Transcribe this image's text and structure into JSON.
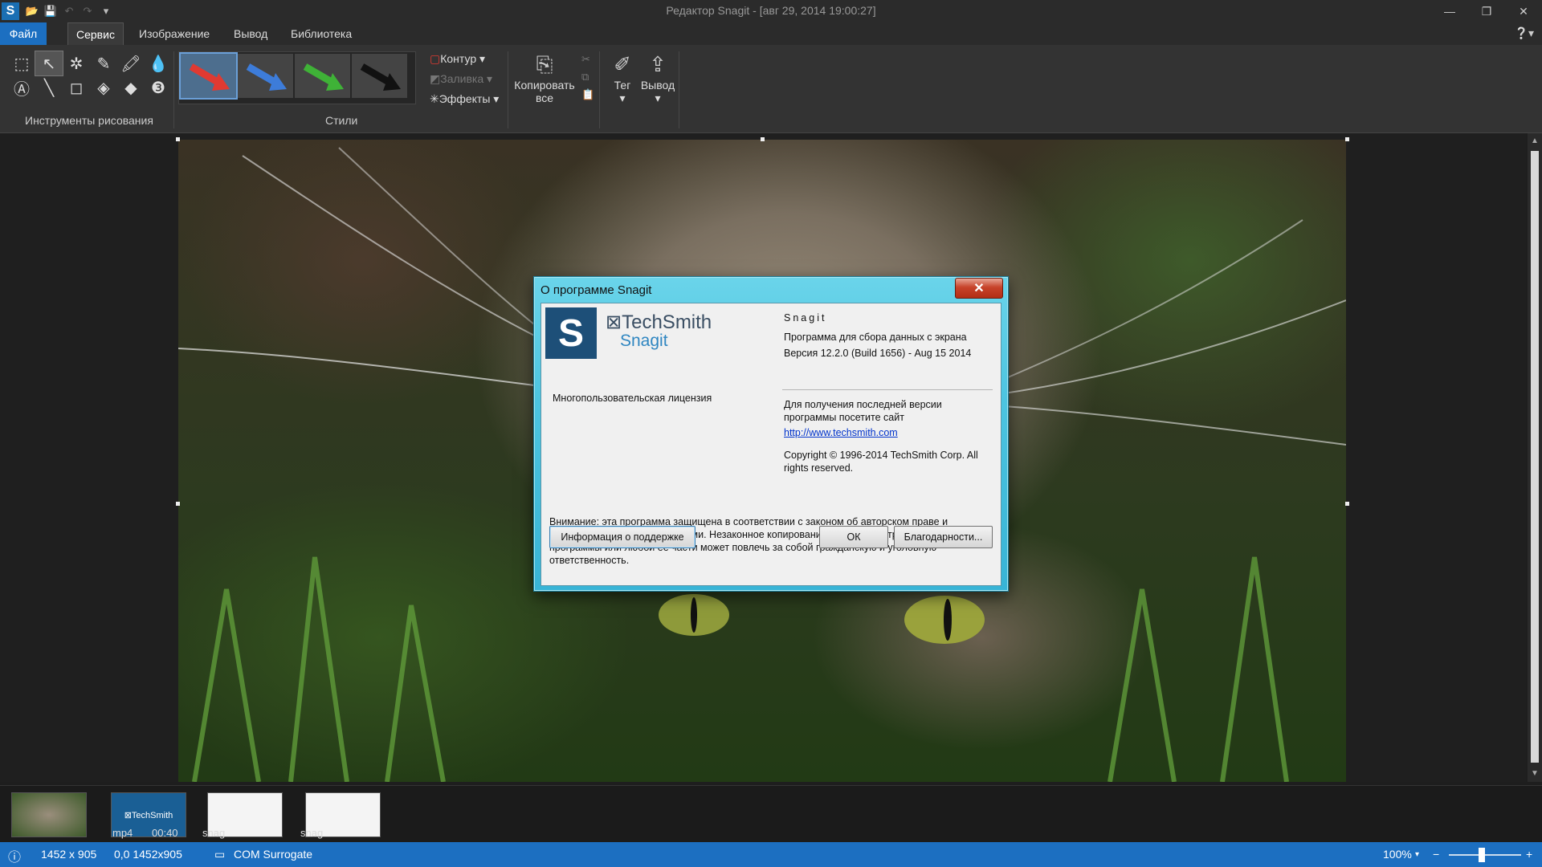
{
  "window": {
    "title": "Редактор Snagit - [авг 29, 2014 19:00:27]"
  },
  "menu": {
    "tabs": [
      "Файл",
      "Сервис",
      "Изображение",
      "Вывод",
      "Библиотека"
    ]
  },
  "ribbon": {
    "drawing_tools_label": "Инструменты рисования",
    "styles_label": "Стили",
    "outline_label": "Контур",
    "fill_label": "Заливка",
    "effects_label": "Эффекты",
    "copy_all_label": "Копировать все",
    "tag_label": "Тег",
    "output_label": "Вывод",
    "style_colors": [
      "#e03a32",
      "#3d7cd9",
      "#3fb237",
      "#111111"
    ]
  },
  "dialog": {
    "title": "О программе Snagit",
    "brand": "TechSmith",
    "product": "Snagit",
    "app_name": "Snagit",
    "description": "Программа для сбора данных с экрана",
    "version": "Версия 12.2.0 (Build 1656) - Aug 15 2014",
    "license": "Многопользовательская лицензия",
    "update_text": "Для получения последней версии программы посетите сайт",
    "url": "http://www.techsmith.com",
    "copyright": "Copyright © 1996-2014 TechSmith Corp. All rights reserved.",
    "warning": "Внимание: эта программа защищена в соответствии с законом об авторском праве и международными соглашениями. Незаконное копирование или распространение данной программы или любой её части может повлечь за собой гражданскую и уголовную ответственность.",
    "support_button": "Информация о поддержке",
    "ok_button": "ОК",
    "thanks_button": "Благодарности..."
  },
  "tray": {
    "items": [
      {
        "type": "",
        "duration": ""
      },
      {
        "type": "mp4",
        "duration": "00:40"
      },
      {
        "type": "snag",
        "duration": ""
      },
      {
        "type": "snag",
        "duration": ""
      }
    ]
  },
  "status": {
    "dimensions": "1452 x 905",
    "selection": "0,0  1452x905",
    "process": "COM Surrogate",
    "zoom": "100%"
  }
}
